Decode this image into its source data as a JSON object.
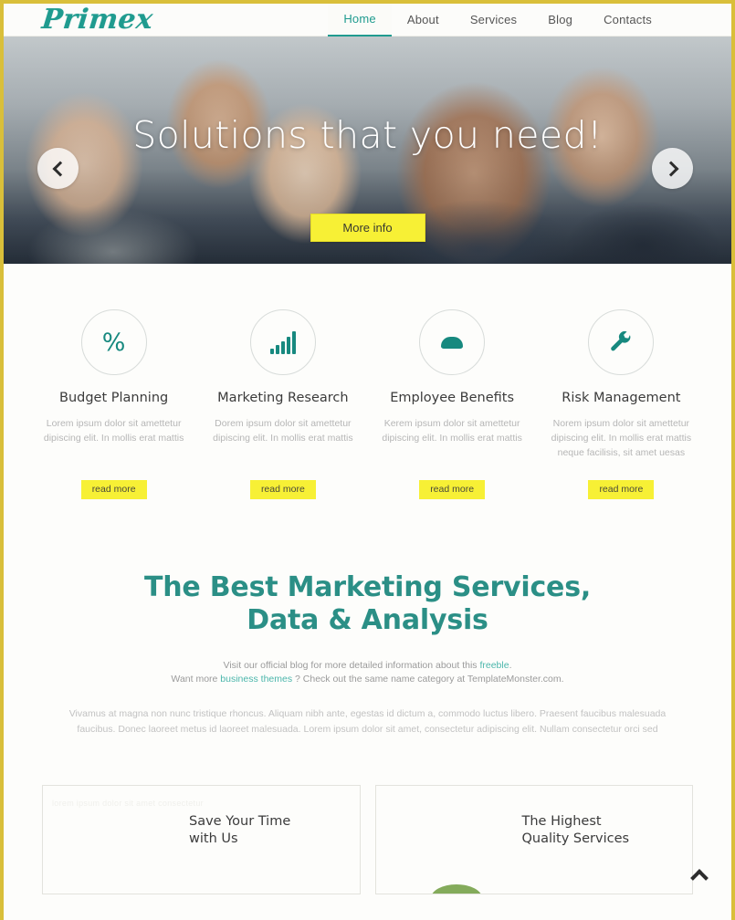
{
  "site": {
    "logo_text": "Primex",
    "brand_teal": "#1f9b8f",
    "accent_yellow": "#f7f035",
    "frame_gold": "#d9bf3a"
  },
  "nav": {
    "items": [
      {
        "label": "Home",
        "active": true
      },
      {
        "label": "About",
        "active": false
      },
      {
        "label": "Services",
        "active": false
      },
      {
        "label": "Blog",
        "active": false
      },
      {
        "label": "Contacts",
        "active": false
      }
    ]
  },
  "hero": {
    "title": "Solutions that you need!",
    "button_label": "More info",
    "prev_icon": "chevron-left-icon",
    "next_icon": "chevron-right-icon"
  },
  "features": [
    {
      "icon": "percent-icon",
      "title": "Budget Planning",
      "description": "Lorem ipsum dolor sit amettetur dipiscing elit. In mollis erat mattis",
      "button_label": "read more"
    },
    {
      "icon": "bar-chart-icon",
      "title": "Marketing Research",
      "description": "Dorem ipsum dolor sit amettetur dipiscing elit. In mollis erat mattis",
      "button_label": "read more"
    },
    {
      "icon": "user-icon",
      "title": "Employee Benefits",
      "description": "Kerem ipsum dolor sit amettetur dipiscing elit. In mollis erat mattis",
      "button_label": "read more"
    },
    {
      "icon": "wrench-icon",
      "title": "Risk Management",
      "description": "Norem ipsum dolor sit amettetur dipiscing elit. In mollis erat mattis neque facilisis, sit amet uesas",
      "button_label": "read more"
    }
  ],
  "marketing": {
    "heading_line1": "The Best Marketing Services,",
    "heading_line2": "Data & Analysis",
    "note_line1_prefix": "Visit our official blog for more detailed information about this ",
    "note_line1_link": "freeble",
    "note_line1_suffix": ".",
    "note_line2_prefix": "Want more ",
    "note_line2_link": "business themes",
    "note_line2_suffix": " ? Check out the same name category at TemplateMonster.com.",
    "body": "Vivamus at magna non nunc tristique rhoncus. Aliquam nibh ante, egestas id dictum a, commodo luctus libero. Praesent faucibus malesuada faucibus. Donec laoreet metus id laoreet malesuada. Lorem ipsum dolor sit amet, consectetur adipiscing elit. Nullam consectetur orci sed"
  },
  "cards": [
    {
      "faint_text": "lorem ipsum dolor sit amet consectetur",
      "title_line1": "Save Your Time",
      "title_line2": "with Us"
    },
    {
      "faint_text": "",
      "title_line1": "The Highest",
      "title_line2": "Quality Services"
    }
  ],
  "scroll_top": {
    "icon": "chevron-up-icon"
  }
}
